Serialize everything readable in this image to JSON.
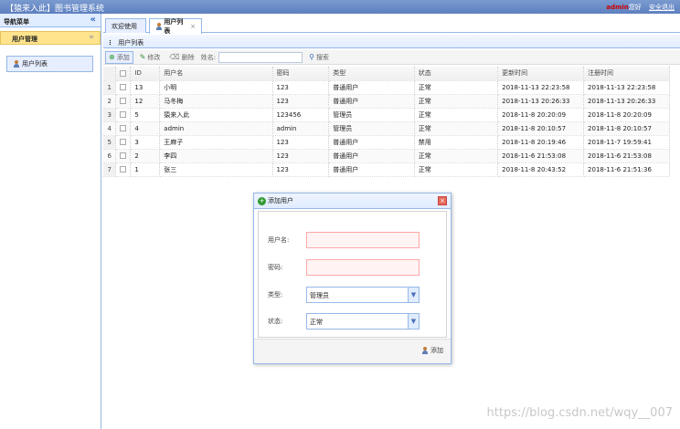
{
  "app": {
    "title": "【猿来入此】图书管理系统",
    "user": "admin",
    "greeting": "您好",
    "logout": "安全退出"
  },
  "sidebar": {
    "title": "导航菜单",
    "collapse_icon": "«",
    "group": "用户管理",
    "group_icon": "»",
    "item": "用户列表"
  },
  "tabs": {
    "welcome": "欢迎使用",
    "users": "用户列表",
    "close": "×"
  },
  "panel": {
    "title": "用户列表"
  },
  "toolbar": {
    "add": "添加",
    "edit": "修改",
    "delete": "删除",
    "name_label": "姓名:",
    "search": "搜索"
  },
  "table": {
    "headers": [
      "ID",
      "用户名",
      "密码",
      "类型",
      "状态",
      "更新时间",
      "注册时间"
    ],
    "rows": [
      [
        "1",
        "13",
        "小明",
        "123",
        "普通用户",
        "正常",
        "2018-11-13 22:23:58",
        "2018-11-13 22:23:58"
      ],
      [
        "2",
        "12",
        "马冬梅",
        "123",
        "普通用户",
        "正常",
        "2018-11-13 20:26:33",
        "2018-11-13 20:26:33"
      ],
      [
        "3",
        "5",
        "猿来入此",
        "123456",
        "管理员",
        "正常",
        "2018-11-8 20:20:09",
        "2018-11-8 20:20:09"
      ],
      [
        "4",
        "4",
        "admin",
        "admin",
        "管理员",
        "正常",
        "2018-11-8 20:10:57",
        "2018-11-8 20:10:57"
      ],
      [
        "5",
        "3",
        "王麻子",
        "123",
        "普通用户",
        "禁用",
        "2018-11-8 20:19:46",
        "2018-11-7 19:59:41"
      ],
      [
        "6",
        "2",
        "李四",
        "123",
        "普通用户",
        "正常",
        "2018-11-6 21:53:08",
        "2018-11-6 21:53:08"
      ],
      [
        "7",
        "1",
        "张三",
        "123",
        "普通用户",
        "正常",
        "2018-11-8 20:43:52",
        "2018-11-6 21:51:36"
      ]
    ]
  },
  "dialog": {
    "title": "添加用户",
    "close": "×",
    "username_label": "用户名:",
    "password_label": "密码:",
    "type_label": "类型:",
    "type_value": "管理员",
    "status_label": "状态:",
    "status_value": "正常",
    "submit": "添加"
  },
  "watermark": "https://blog.csdn.net/wqy__007"
}
